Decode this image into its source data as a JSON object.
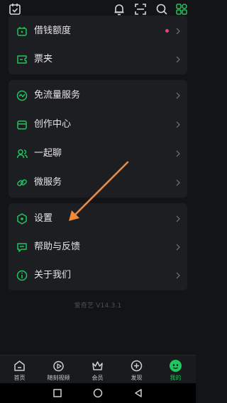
{
  "menu": {
    "card1": [
      {
        "id": "borrow",
        "label": "借钱额度",
        "icon": "wallet-icon",
        "has_dot": true
      },
      {
        "id": "tickets",
        "label": "票夹",
        "icon": "ticket-icon",
        "has_dot": false
      }
    ],
    "card2": [
      {
        "id": "free-data",
        "label": "免流量服务",
        "icon": "data-flow-icon"
      },
      {
        "id": "creator",
        "label": "创作中心",
        "icon": "creator-icon"
      },
      {
        "id": "chat",
        "label": "一起聊",
        "icon": "chat-people-icon"
      },
      {
        "id": "micro",
        "label": "微服务",
        "icon": "link-icon"
      }
    ],
    "card3": [
      {
        "id": "settings",
        "label": "设置",
        "icon": "settings-hexagon-icon"
      },
      {
        "id": "help",
        "label": "帮助与反馈",
        "icon": "feedback-icon"
      },
      {
        "id": "about",
        "label": "关于我们",
        "icon": "info-icon"
      }
    ]
  },
  "version_text": "爱奇艺 V14.3.1",
  "tabs": [
    {
      "label": "首页",
      "icon": "home-icon",
      "active": false
    },
    {
      "label": "随刻视频",
      "icon": "play-icon",
      "active": false
    },
    {
      "label": "会员",
      "icon": "crown-icon",
      "active": false
    },
    {
      "label": "发现",
      "icon": "plus-circle-icon",
      "active": false
    },
    {
      "label": "我的",
      "icon": "profile-icon",
      "active": true
    }
  ],
  "colors": {
    "background": "#131416",
    "card": "#1d1e21",
    "accent_green": "#1fc55e",
    "annotation_arrow": "#f0893a",
    "notification_dot": "#e8436a"
  }
}
